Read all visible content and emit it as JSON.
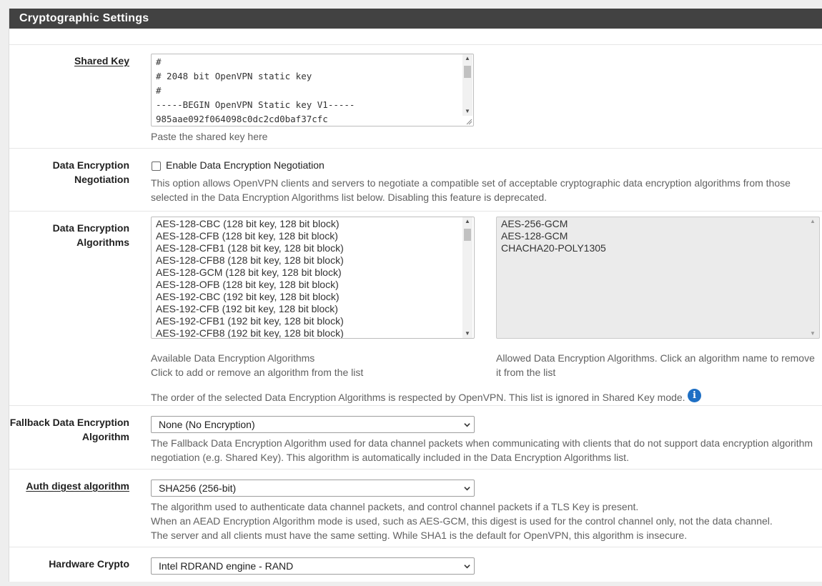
{
  "panel": {
    "title": "Cryptographic Settings"
  },
  "shared_key": {
    "label": "Shared Key",
    "lines": [
      "#",
      "# 2048 bit OpenVPN static key",
      "#",
      "-----BEGIN OpenVPN Static key V1-----",
      "985aae092f064098c0dc2cd0baf37cfc"
    ],
    "help": "Paste the shared key here"
  },
  "ncp": {
    "label_line1": "Data Encryption",
    "label_line2": "Negotiation",
    "checkbox_label": "Enable Data Encryption Negotiation",
    "checked": false,
    "help_line1": "This option allows OpenVPN clients and servers to negotiate a compatible set of acceptable cryptographic data encryption algorithms from those",
    "help_line2": "selected in the Data Encryption Algorithms list below. Disabling this feature is deprecated."
  },
  "algorithms": {
    "label_line1": "Data Encryption",
    "label_line2": "Algorithms",
    "available": [
      "AES-128-CBC (128 bit key, 128 bit block)",
      "AES-128-CFB (128 bit key, 128 bit block)",
      "AES-128-CFB1 (128 bit key, 128 bit block)",
      "AES-128-CFB8 (128 bit key, 128 bit block)",
      "AES-128-GCM (128 bit key, 128 bit block)",
      "AES-128-OFB (128 bit key, 128 bit block)",
      "AES-192-CBC (192 bit key, 128 bit block)",
      "AES-192-CFB (192 bit key, 128 bit block)",
      "AES-192-CFB1 (192 bit key, 128 bit block)",
      "AES-192-CFB8 (192 bit key, 128 bit block)"
    ],
    "allowed": [
      "AES-256-GCM",
      "AES-128-GCM",
      "CHACHA20-POLY1305"
    ],
    "available_help_line1": "Available Data Encryption Algorithms",
    "available_help_line2": "Click to add or remove an algorithm from the list",
    "allowed_help_line1": "Allowed Data Encryption Algorithms. Click an algorithm name to remove",
    "allowed_help_line2": "it from the list",
    "order_note": "The order of the selected Data Encryption Algorithms is respected by OpenVPN. This list is ignored in Shared Key mode."
  },
  "fallback": {
    "label_line1": "Fallback Data Encryption",
    "label_line2": "Algorithm",
    "value": "None (No Encryption)",
    "help_line1": "The Fallback Data Encryption Algorithm used for data channel packets when communicating with clients that do not support data encryption algorithm",
    "help_line2": "negotiation (e.g. Shared Key). This algorithm is automatically included in the Data Encryption Algorithms list."
  },
  "auth_digest": {
    "label": "Auth digest algorithm",
    "value": "SHA256 (256-bit)",
    "help_line1": "The algorithm used to authenticate data channel packets, and control channel packets if a TLS Key is present.",
    "help_line2": "When an AEAD Encryption Algorithm mode is used, such as AES-GCM, this digest is used for the control channel only, not the data channel.",
    "help_line3": "The server and all clients must have the same setting. While SHA1 is the default for OpenVPN, this algorithm is insecure."
  },
  "hardware_crypto": {
    "label": "Hardware Crypto",
    "value": "Intel RDRAND engine - RAND"
  },
  "icons": {
    "info": "info-icon",
    "chevron": "chevron-down-icon"
  },
  "colors": {
    "heading_bg": "#424242",
    "info_blue": "#1e6fc4"
  }
}
